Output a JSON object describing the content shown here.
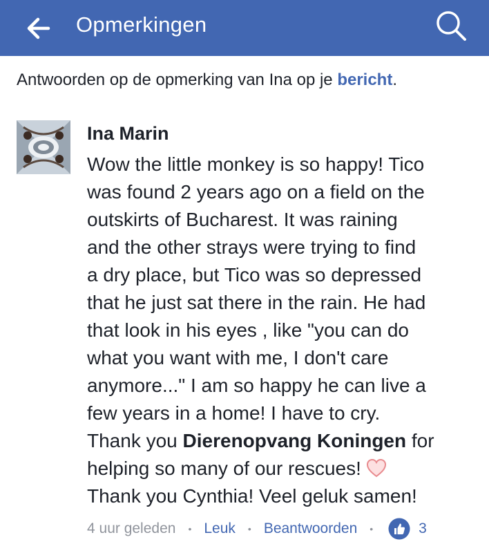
{
  "header": {
    "title": "Opmerkingen"
  },
  "context": {
    "prefix": "Antwoorden op de opmerking van Ina op je ",
    "link": "bericht",
    "suffix": "."
  },
  "comment": {
    "author": "Ina Marin",
    "lines": [
      "Wow the little monkey is so happy! Tico",
      "was found 2 years ago on a field on the",
      "outskirts of Bucharest. It was raining",
      "and the other strays were trying to find",
      "a dry place, but Tico was so depressed",
      "that he just sat there in the rain. He had",
      "that look in his eyes , like \"you can do",
      "what you want with me, I don't care",
      "anymore...\" I am so happy he can live a",
      "few years in a home! I have to cry."
    ],
    "thanks_prefix": "Thank you ",
    "mention": "Dierenopvang Koningen",
    "thanks_suffix": " for",
    "line_helping": "helping so many of our rescues!",
    "line_last": "Thank you Cynthia! Veel geluk samen!",
    "timestamp": "4 uur geleden",
    "like_label": "Leuk",
    "reply_label": "Beantwoorden",
    "like_count": "3",
    "separator": "•"
  },
  "colors": {
    "brand": "#4267b2",
    "meta": "#90949c",
    "heart": "#f5a5a8"
  },
  "icons": {
    "back": "arrow-left-icon",
    "search": "search-icon",
    "heart": "heart-emoji-icon",
    "like": "thumbs-up-icon"
  }
}
